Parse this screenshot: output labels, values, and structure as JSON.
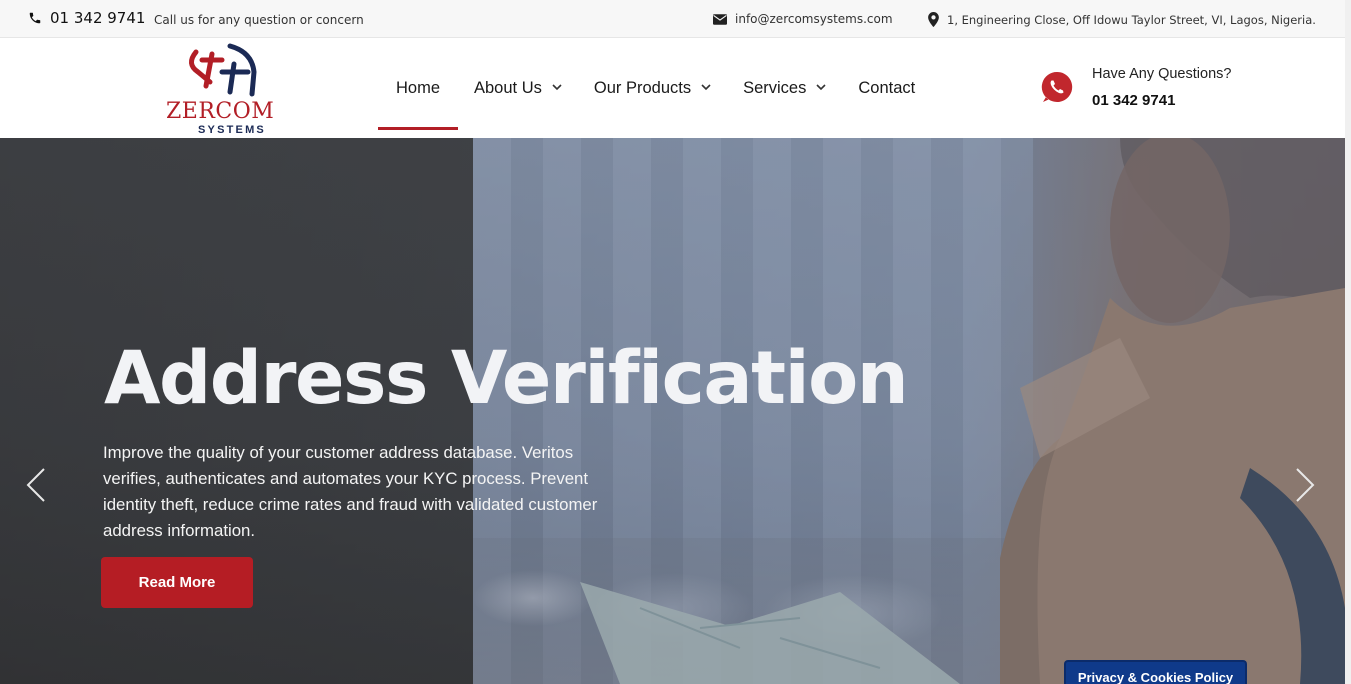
{
  "topbar": {
    "phone": "01 342 9741",
    "call_note": "Call us for any question or concern",
    "email": "info@zercomsystems.com",
    "address": "1, Engineering Close, Off Idowu Taylor Street, VI, Lagos, Nigeria."
  },
  "logo": {
    "name": "ZERCOM",
    "sub": "SYSTEMS"
  },
  "nav": {
    "items": [
      {
        "label": "Home",
        "active": true,
        "dropdown": false
      },
      {
        "label": "About Us",
        "active": false,
        "dropdown": true
      },
      {
        "label": "Our Products",
        "active": false,
        "dropdown": true
      },
      {
        "label": "Services",
        "active": false,
        "dropdown": true
      },
      {
        "label": "Contact",
        "active": false,
        "dropdown": false
      }
    ]
  },
  "cta": {
    "question": "Have Any Questions?",
    "number": "01 342 9741"
  },
  "hero": {
    "title": "Address Verification",
    "text": "Improve the quality of your customer address database. Veritos verifies, authenticates and automates your KYC process. Prevent identity theft, reduce crime rates and fraud with validated customer address information.",
    "button": "Read More"
  },
  "privacy": {
    "label": "Privacy & Cookies Policy"
  },
  "colors": {
    "accent": "#b51d24",
    "navy": "#1b2a55",
    "privacy_bg": "#0f3a8a",
    "whatsapp": "#c1272d"
  },
  "icons": {
    "phone": "phone-icon",
    "email": "envelope-icon",
    "address": "map-pin-icon",
    "whatsapp": "whatsapp-icon",
    "prev": "chevron-left-icon",
    "next": "chevron-right-icon"
  }
}
